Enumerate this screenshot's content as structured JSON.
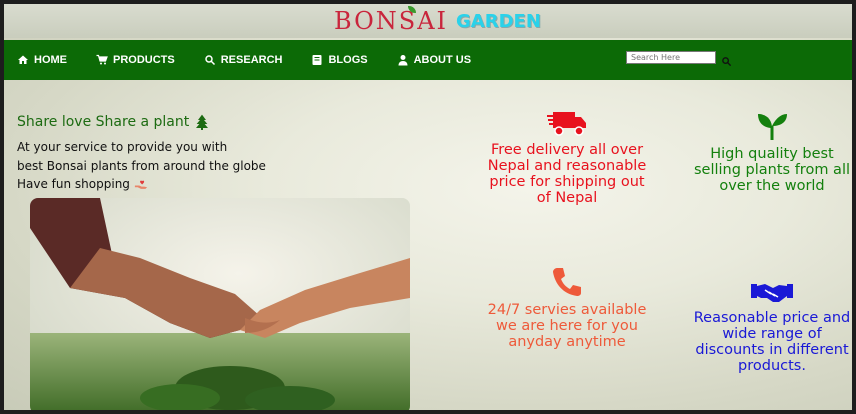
{
  "brand": {
    "part1": "BONSAI",
    "part2": "GARDEN"
  },
  "nav": {
    "items": [
      {
        "label": "HOME",
        "icon": "home-icon"
      },
      {
        "label": "PRODUCTS",
        "icon": "cart-icon"
      },
      {
        "label": "RESEARCH",
        "icon": "search-icon"
      },
      {
        "label": "BLOGS",
        "icon": "blog-icon"
      },
      {
        "label": "ABOUT US",
        "icon": "user-icon"
      }
    ],
    "search": {
      "placeholder": "Search Here"
    }
  },
  "hero": {
    "tagline": "Share love Share a plant",
    "intro_lines": [
      "At your service to provide you with",
      "best Bonsai plants from around the globe",
      "Have fun shopping"
    ]
  },
  "features": [
    {
      "icon": "truck-icon",
      "text": "Free delivery all over Nepal and reasonable price for shipping out of Nepal"
    },
    {
      "icon": "leaf-icon",
      "text": "High quality best selling plants from all over the world"
    },
    {
      "icon": "phone-icon",
      "text": "24/7 servies available we are here for you anyday anytime"
    },
    {
      "icon": "handshake-icon",
      "text": "Reasonable price and wide range of discounts in different products."
    }
  ],
  "colors": {
    "nav_bg": "#0c6a06",
    "brand_red": "#c9253c",
    "brand_cyan": "#2ad2ea",
    "feature_red": "#e8121e",
    "feature_green": "#14800e",
    "feature_orange": "#ee5a3a",
    "feature_blue": "#1a19d6"
  }
}
